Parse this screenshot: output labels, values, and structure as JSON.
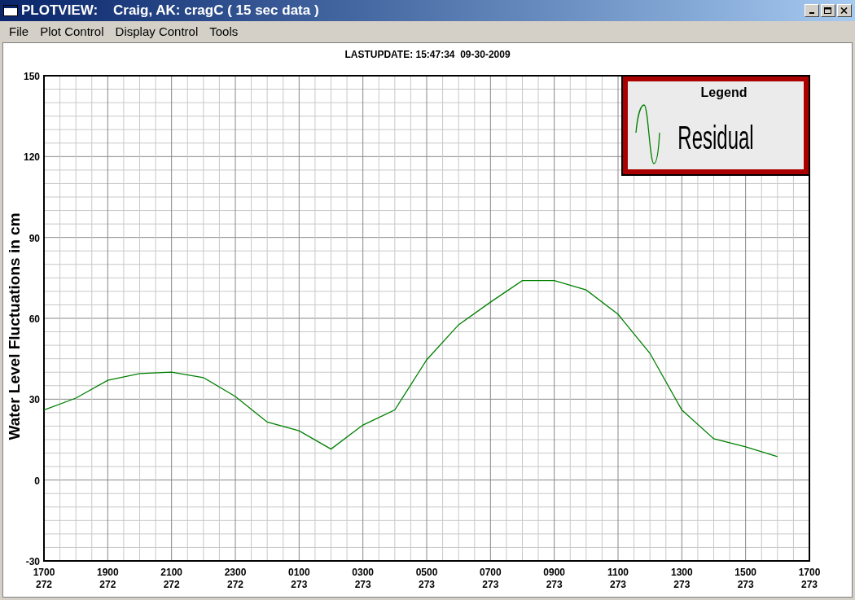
{
  "window": {
    "title": "PLOTVIEW:    Craig, AK: cragC ( 15 sec data )"
  },
  "menu": [
    "File",
    "Plot Control",
    "Display Control",
    "Tools"
  ],
  "last_update": "LASTUPDATE: 15:47:34  09-30-2009",
  "plot": {
    "legend_title": "Legend",
    "chart_data": {
      "type": "line",
      "ylabel": "Water Level Fluctuations in cm",
      "categories": [
        "1700\n272",
        null,
        "1900\n272",
        null,
        "2100\n272",
        null,
        "2300\n272",
        null,
        "0100\n273",
        null,
        "0300\n273",
        null,
        "0500\n273",
        null,
        "0700\n273",
        null,
        "0900\n273",
        null,
        "1100\n273",
        null,
        "1300\n273",
        null,
        "1500\n273",
        null,
        "1700\n273"
      ],
      "series": [
        {
          "name": "Residual",
          "color": "#008000",
          "values": [
            26,
            30.4,
            37,
            39.5,
            40,
            38,
            31,
            21.5,
            18.3,
            11.5,
            20.4,
            26,
            44.6,
            57.6,
            66,
            74,
            74,
            70.5,
            61.5,
            47,
            26,
            15.3,
            12.3,
            8.7,
            null
          ]
        }
      ],
      "ylim": [
        -30,
        150
      ],
      "grid": true,
      "yticks": [
        -30,
        0,
        30,
        60,
        90,
        120,
        150
      ]
    }
  }
}
